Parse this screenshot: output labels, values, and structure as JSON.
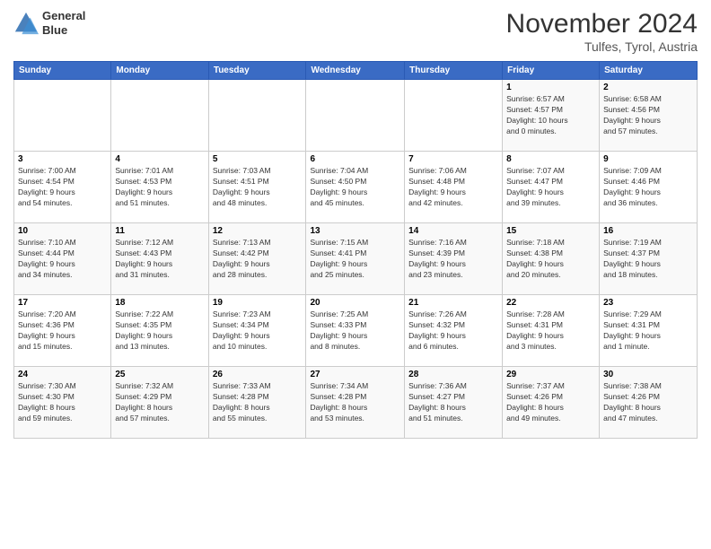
{
  "logo": {
    "line1": "General",
    "line2": "Blue"
  },
  "title": "November 2024",
  "subtitle": "Tulfes, Tyrol, Austria",
  "weekdays": [
    "Sunday",
    "Monday",
    "Tuesday",
    "Wednesday",
    "Thursday",
    "Friday",
    "Saturday"
  ],
  "weeks": [
    [
      {
        "day": "",
        "info": ""
      },
      {
        "day": "",
        "info": ""
      },
      {
        "day": "",
        "info": ""
      },
      {
        "day": "",
        "info": ""
      },
      {
        "day": "",
        "info": ""
      },
      {
        "day": "1",
        "info": "Sunrise: 6:57 AM\nSunset: 4:57 PM\nDaylight: 10 hours\nand 0 minutes."
      },
      {
        "day": "2",
        "info": "Sunrise: 6:58 AM\nSunset: 4:56 PM\nDaylight: 9 hours\nand 57 minutes."
      }
    ],
    [
      {
        "day": "3",
        "info": "Sunrise: 7:00 AM\nSunset: 4:54 PM\nDaylight: 9 hours\nand 54 minutes."
      },
      {
        "day": "4",
        "info": "Sunrise: 7:01 AM\nSunset: 4:53 PM\nDaylight: 9 hours\nand 51 minutes."
      },
      {
        "day": "5",
        "info": "Sunrise: 7:03 AM\nSunset: 4:51 PM\nDaylight: 9 hours\nand 48 minutes."
      },
      {
        "day": "6",
        "info": "Sunrise: 7:04 AM\nSunset: 4:50 PM\nDaylight: 9 hours\nand 45 minutes."
      },
      {
        "day": "7",
        "info": "Sunrise: 7:06 AM\nSunset: 4:48 PM\nDaylight: 9 hours\nand 42 minutes."
      },
      {
        "day": "8",
        "info": "Sunrise: 7:07 AM\nSunset: 4:47 PM\nDaylight: 9 hours\nand 39 minutes."
      },
      {
        "day": "9",
        "info": "Sunrise: 7:09 AM\nSunset: 4:46 PM\nDaylight: 9 hours\nand 36 minutes."
      }
    ],
    [
      {
        "day": "10",
        "info": "Sunrise: 7:10 AM\nSunset: 4:44 PM\nDaylight: 9 hours\nand 34 minutes."
      },
      {
        "day": "11",
        "info": "Sunrise: 7:12 AM\nSunset: 4:43 PM\nDaylight: 9 hours\nand 31 minutes."
      },
      {
        "day": "12",
        "info": "Sunrise: 7:13 AM\nSunset: 4:42 PM\nDaylight: 9 hours\nand 28 minutes."
      },
      {
        "day": "13",
        "info": "Sunrise: 7:15 AM\nSunset: 4:41 PM\nDaylight: 9 hours\nand 25 minutes."
      },
      {
        "day": "14",
        "info": "Sunrise: 7:16 AM\nSunset: 4:39 PM\nDaylight: 9 hours\nand 23 minutes."
      },
      {
        "day": "15",
        "info": "Sunrise: 7:18 AM\nSunset: 4:38 PM\nDaylight: 9 hours\nand 20 minutes."
      },
      {
        "day": "16",
        "info": "Sunrise: 7:19 AM\nSunset: 4:37 PM\nDaylight: 9 hours\nand 18 minutes."
      }
    ],
    [
      {
        "day": "17",
        "info": "Sunrise: 7:20 AM\nSunset: 4:36 PM\nDaylight: 9 hours\nand 15 minutes."
      },
      {
        "day": "18",
        "info": "Sunrise: 7:22 AM\nSunset: 4:35 PM\nDaylight: 9 hours\nand 13 minutes."
      },
      {
        "day": "19",
        "info": "Sunrise: 7:23 AM\nSunset: 4:34 PM\nDaylight: 9 hours\nand 10 minutes."
      },
      {
        "day": "20",
        "info": "Sunrise: 7:25 AM\nSunset: 4:33 PM\nDaylight: 9 hours\nand 8 minutes."
      },
      {
        "day": "21",
        "info": "Sunrise: 7:26 AM\nSunset: 4:32 PM\nDaylight: 9 hours\nand 6 minutes."
      },
      {
        "day": "22",
        "info": "Sunrise: 7:28 AM\nSunset: 4:31 PM\nDaylight: 9 hours\nand 3 minutes."
      },
      {
        "day": "23",
        "info": "Sunrise: 7:29 AM\nSunset: 4:31 PM\nDaylight: 9 hours\nand 1 minute."
      }
    ],
    [
      {
        "day": "24",
        "info": "Sunrise: 7:30 AM\nSunset: 4:30 PM\nDaylight: 8 hours\nand 59 minutes."
      },
      {
        "day": "25",
        "info": "Sunrise: 7:32 AM\nSunset: 4:29 PM\nDaylight: 8 hours\nand 57 minutes."
      },
      {
        "day": "26",
        "info": "Sunrise: 7:33 AM\nSunset: 4:28 PM\nDaylight: 8 hours\nand 55 minutes."
      },
      {
        "day": "27",
        "info": "Sunrise: 7:34 AM\nSunset: 4:28 PM\nDaylight: 8 hours\nand 53 minutes."
      },
      {
        "day": "28",
        "info": "Sunrise: 7:36 AM\nSunset: 4:27 PM\nDaylight: 8 hours\nand 51 minutes."
      },
      {
        "day": "29",
        "info": "Sunrise: 7:37 AM\nSunset: 4:26 PM\nDaylight: 8 hours\nand 49 minutes."
      },
      {
        "day": "30",
        "info": "Sunrise: 7:38 AM\nSunset: 4:26 PM\nDaylight: 8 hours\nand 47 minutes."
      }
    ]
  ]
}
